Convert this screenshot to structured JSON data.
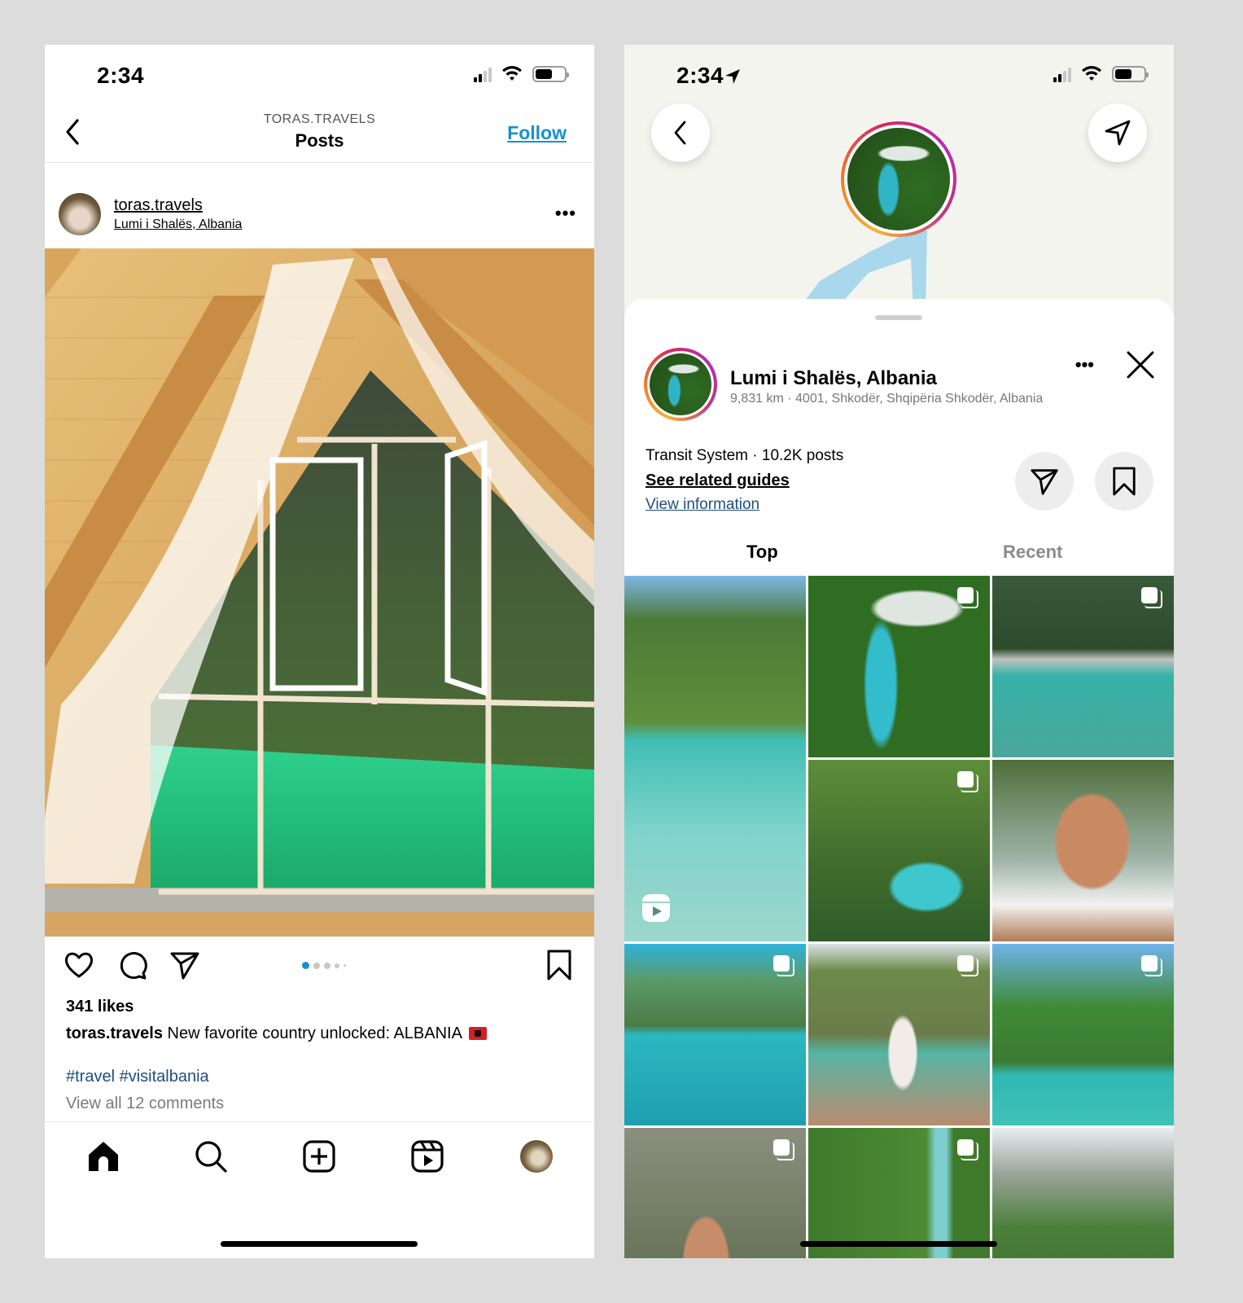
{
  "left": {
    "status": {
      "time": "2:34",
      "battery_percent": 60
    },
    "header": {
      "username": "TORAS.TRAVELS",
      "title": "Posts",
      "follow_label": "Follow",
      "follow_color": "#1a8fd1"
    },
    "post": {
      "author": "toras.travels",
      "location": "Lumi i Shalës, Albania",
      "more_label": "•••",
      "carousel": {
        "count": 5,
        "active_index": 0,
        "active_color": "#1a8fd1"
      },
      "likes": "341 likes",
      "caption_author": "toras.travels",
      "caption_text": "New favorite country unlocked: ALBANIA",
      "caption_emoji": "albania-flag",
      "hashtags": "#travel #visitalbania",
      "comments_link": "View all 12 comments"
    },
    "tabbar": {
      "items": [
        {
          "name": "home",
          "icon": "home-icon",
          "active": true
        },
        {
          "name": "search",
          "icon": "search-icon"
        },
        {
          "name": "create",
          "icon": "plus-square-icon"
        },
        {
          "name": "reels",
          "icon": "reels-icon"
        },
        {
          "name": "profile",
          "icon": "avatar"
        }
      ]
    }
  },
  "right": {
    "status": {
      "time": "2:34",
      "battery_percent": 60
    },
    "location": {
      "name": "Lumi i Shalës, Albania",
      "address": "9,831 km · 4001, Shkodër, Shqipëria Shkodër, Albania",
      "meta": "Transit System · 10.2K posts",
      "related_guides": "See related guides",
      "view_information": "View information",
      "more_label": "•••"
    },
    "tabs": [
      {
        "label": "Top",
        "active": true,
        "color": "#000000"
      },
      {
        "label": "Recent",
        "active": false,
        "color": "#8a8a8a"
      }
    ],
    "grid": [
      {
        "scene": "river-canyon-clear-water",
        "badge": "reel"
      },
      {
        "scene": "aerial-river-forest",
        "badge": "multi"
      },
      {
        "scene": "woman-green-bikini-beach",
        "badge": "multi"
      },
      {
        "scene": "tree-over-river-restaurant",
        "badge": "multi"
      },
      {
        "scene": "woman-selfie-shading-eyes",
        "badge": ""
      },
      {
        "scene": "boat-turquoise-lake",
        "badge": "multi"
      },
      {
        "scene": "woman-on-wooden-bridge",
        "badge": "multi"
      },
      {
        "scene": "cliffs-turquoise-lagoon",
        "badge": "multi"
      },
      {
        "scene": "woman-rock-wall",
        "badge": "multi"
      },
      {
        "scene": "aerial-river-green",
        "badge": "multi"
      },
      {
        "scene": "mountain-cliffs",
        "badge": ""
      }
    ]
  }
}
